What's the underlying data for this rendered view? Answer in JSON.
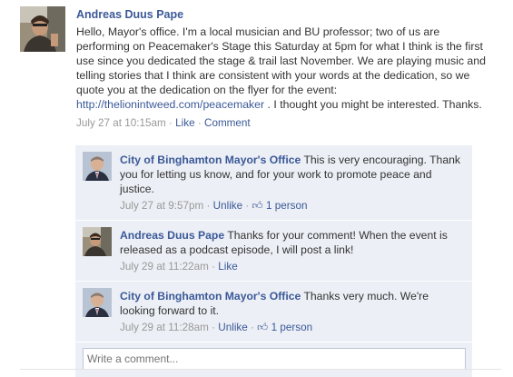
{
  "post": {
    "author": "Andreas Duus Pape",
    "text_before_link": "Hello, Mayor's office. I'm a local musician and BU professor; two of us are performing on Peacemaker's Stage this Saturday at 5pm for what I think is the first use since you dedicated the stage & trail last November. We are playing music and telling stories that I think are consistent with your words at the dedication, so we quote you at the dedication on the flyer for the event: ",
    "link": "http://thelionintweed.com/peacemaker",
    "text_after_link": " . I thought you might be interested. Thanks.",
    "timestamp": "July 27 at 10:15am",
    "like_label": "Like",
    "comment_label": "Comment",
    "avatar_icon": "person-photo-icon"
  },
  "comments": [
    {
      "author": "City of Binghamton Mayor's Office",
      "text": "This is very encouraging. Thank you for letting us know, and for your work to promote peace and justice.",
      "timestamp": "July 27 at 9:57pm",
      "action": "Unlike",
      "likes": "1 person",
      "avatar_icon": "mayor-photo-icon"
    },
    {
      "author": "Andreas Duus Pape",
      "text": "Thanks for your comment! When the event is released as a podcast episode, I will post a link!",
      "timestamp": "July 29 at 11:22am",
      "action": "Like",
      "likes": "",
      "avatar_icon": "person-photo-icon"
    },
    {
      "author": "City of Binghamton Mayor's Office",
      "text": "Thanks very much. We're looking forward to it.",
      "timestamp": "July 29 at 11:28am",
      "action": "Unlike",
      "likes": "1 person",
      "avatar_icon": "mayor-photo-icon"
    }
  ],
  "write_comment": {
    "placeholder": "Write a comment..."
  },
  "colors": {
    "link": "#3b5998",
    "comment_bg": "#eceff5",
    "meta": "#999999"
  }
}
